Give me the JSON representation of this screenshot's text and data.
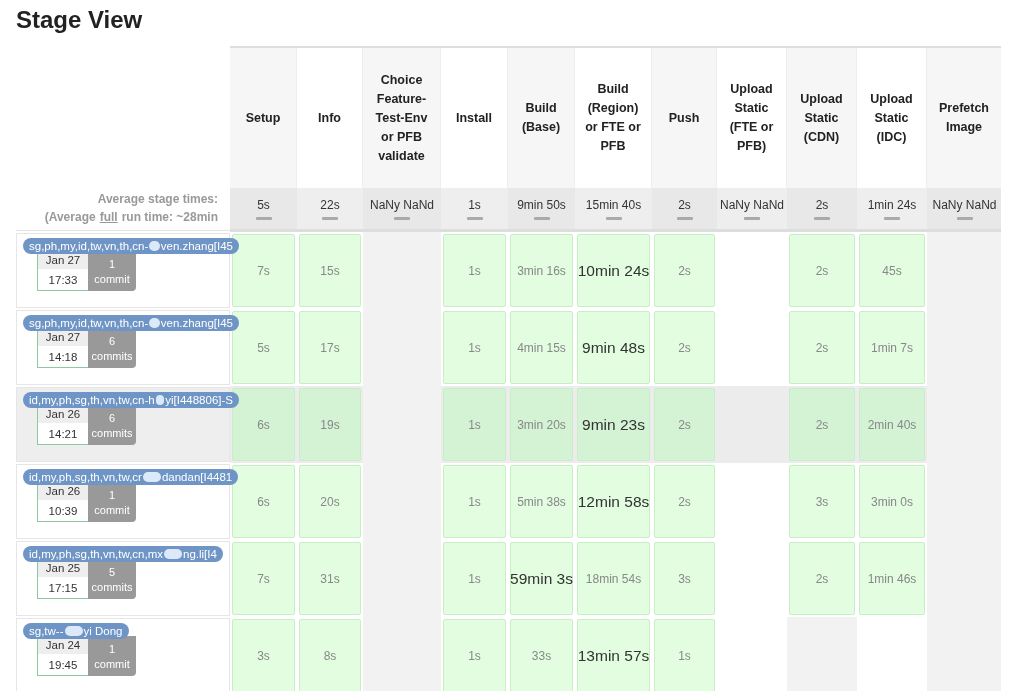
{
  "title": "Stage View",
  "summary": {
    "heading": "Average stage times:",
    "run_time_before": "(Average",
    "run_time_link": "full",
    "run_time_after": "run time: ~28min"
  },
  "stages": [
    {
      "label": "Setup",
      "average": "5s"
    },
    {
      "label": "Info",
      "average": "22s"
    },
    {
      "label": "Choice Feature-Test-Env or PFB validate",
      "average": "NaNy NaNd"
    },
    {
      "label": "Install",
      "average": "1s"
    },
    {
      "label": "Build (Base)",
      "average": "9min 50s"
    },
    {
      "label": "Build (Region) or FTE or PFB",
      "average": "15min 40s"
    },
    {
      "label": "Push",
      "average": "2s"
    },
    {
      "label": "Upload Static (FTE or PFB)",
      "average": "NaNy NaNd"
    },
    {
      "label": "Upload Static (CDN)",
      "average": "2s"
    },
    {
      "label": "Upload Static (IDC)",
      "average": "1min 24s"
    },
    {
      "label": "Prefetch Image",
      "average": "NaNy NaNd"
    }
  ],
  "runs": [
    {
      "branch_before": "sg,ph,my,id,tw,vn,th,cn-",
      "branch_after": "ven.zhang[I45",
      "date": "Jan 27",
      "time": "17:33",
      "commit_count": "1",
      "commit_label": "commit",
      "highlighted": false,
      "cells": [
        {
          "kind": "done",
          "text": "7s",
          "long": false
        },
        {
          "kind": "done",
          "text": "15s",
          "long": false
        },
        {
          "kind": "empty"
        },
        {
          "kind": "done",
          "text": "1s",
          "long": false
        },
        {
          "kind": "done",
          "text": "3min 16s",
          "long": false
        },
        {
          "kind": "done",
          "text": "10min 24s",
          "long": true
        },
        {
          "kind": "done",
          "text": "2s",
          "long": false
        },
        {
          "kind": "empty"
        },
        {
          "kind": "done",
          "text": "2s",
          "long": false
        },
        {
          "kind": "done",
          "text": "45s",
          "long": false
        },
        {
          "kind": "empty"
        }
      ]
    },
    {
      "branch_before": "sg,ph,my,id,tw,vn,th,cn-",
      "branch_after": "ven.zhang[I45",
      "date": "Jan 27",
      "time": "14:18",
      "commit_count": "6",
      "commit_label": "commits",
      "highlighted": false,
      "cells": [
        {
          "kind": "done",
          "text": "5s",
          "long": false
        },
        {
          "kind": "done",
          "text": "17s",
          "long": false
        },
        {
          "kind": "empty"
        },
        {
          "kind": "done",
          "text": "1s",
          "long": false
        },
        {
          "kind": "done",
          "text": "4min 15s",
          "long": false
        },
        {
          "kind": "done",
          "text": "9min 48s",
          "long": true
        },
        {
          "kind": "done",
          "text": "2s",
          "long": false
        },
        {
          "kind": "empty"
        },
        {
          "kind": "done",
          "text": "2s",
          "long": false
        },
        {
          "kind": "done",
          "text": "1min 7s",
          "long": false
        },
        {
          "kind": "empty"
        }
      ]
    },
    {
      "branch_before": "id,my,ph,sg,th,vn,tw,cn-h",
      "branch_after": "yi[I448806]-S",
      "date": "Jan 26",
      "time": "14:21",
      "commit_count": "6",
      "commit_label": "commits",
      "highlighted": true,
      "cells": [
        {
          "kind": "done",
          "text": "6s",
          "long": false
        },
        {
          "kind": "done",
          "text": "19s",
          "long": false
        },
        {
          "kind": "empty"
        },
        {
          "kind": "done",
          "text": "1s",
          "long": false
        },
        {
          "kind": "done",
          "text": "3min 20s",
          "long": false
        },
        {
          "kind": "done",
          "text": "9min 23s",
          "long": true
        },
        {
          "kind": "done",
          "text": "2s",
          "long": false
        },
        {
          "kind": "empty"
        },
        {
          "kind": "done",
          "text": "2s",
          "long": false
        },
        {
          "kind": "done",
          "text": "2min 40s",
          "long": false
        },
        {
          "kind": "empty"
        }
      ]
    },
    {
      "branch_before": "id,my,ph,sg,th,vn,tw,cr",
      "branch_after": "dandan[I4481",
      "date": "Jan 26",
      "time": "10:39",
      "commit_count": "1",
      "commit_label": "commit",
      "highlighted": false,
      "cells": [
        {
          "kind": "done",
          "text": "6s",
          "long": false
        },
        {
          "kind": "done",
          "text": "20s",
          "long": false
        },
        {
          "kind": "empty"
        },
        {
          "kind": "done",
          "text": "1s",
          "long": false
        },
        {
          "kind": "done",
          "text": "5min 38s",
          "long": false
        },
        {
          "kind": "done",
          "text": "12min 58s",
          "long": true
        },
        {
          "kind": "done",
          "text": "2s",
          "long": false
        },
        {
          "kind": "empty"
        },
        {
          "kind": "done",
          "text": "3s",
          "long": false
        },
        {
          "kind": "done",
          "text": "3min 0s",
          "long": false
        },
        {
          "kind": "empty"
        }
      ]
    },
    {
      "branch_before": "id,my,ph,sg,th,vn,tw,cn,mx",
      "branch_after": "ng.li[I4",
      "date": "Jan 25",
      "time": "17:15",
      "commit_count": "5",
      "commit_label": "commits",
      "highlighted": false,
      "cells": [
        {
          "kind": "done",
          "text": "7s",
          "long": false
        },
        {
          "kind": "done",
          "text": "31s",
          "long": false
        },
        {
          "kind": "empty"
        },
        {
          "kind": "done",
          "text": "1s",
          "long": false
        },
        {
          "kind": "done",
          "text": "59min 3s",
          "long": true
        },
        {
          "kind": "done",
          "text": "18min 54s",
          "long": false
        },
        {
          "kind": "done",
          "text": "3s",
          "long": false
        },
        {
          "kind": "empty"
        },
        {
          "kind": "done",
          "text": "2s",
          "long": false
        },
        {
          "kind": "done",
          "text": "1min 46s",
          "long": false
        },
        {
          "kind": "empty"
        }
      ]
    },
    {
      "branch_before": "sg,tw--",
      "branch_after": "yi Dong",
      "date": "Jan 24",
      "time": "19:45",
      "commit_count": "1",
      "commit_label": "commit",
      "highlighted": false,
      "cells": [
        {
          "kind": "done",
          "text": "3s",
          "long": false
        },
        {
          "kind": "done",
          "text": "8s",
          "long": false
        },
        {
          "kind": "empty"
        },
        {
          "kind": "done",
          "text": "1s",
          "long": false
        },
        {
          "kind": "done",
          "text": "33s",
          "long": false
        },
        {
          "kind": "done",
          "text": "13min 57s",
          "long": true
        },
        {
          "kind": "done",
          "text": "1s",
          "long": false
        },
        {
          "kind": "empty"
        },
        {
          "kind": "empty"
        },
        {
          "kind": "empty"
        },
        {
          "kind": "empty"
        }
      ]
    }
  ]
}
